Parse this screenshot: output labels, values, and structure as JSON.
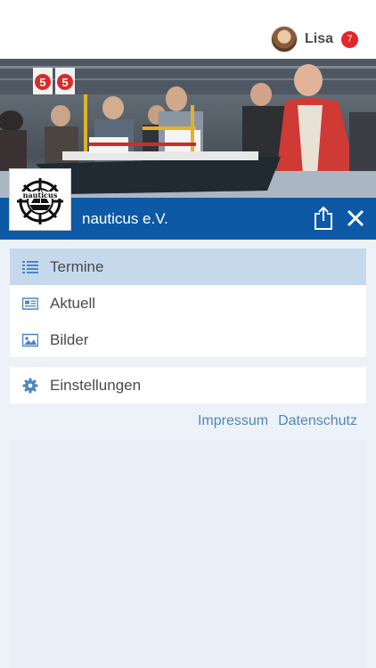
{
  "user": {
    "name": "Lisa",
    "notification_count": "7"
  },
  "organization": {
    "name": "nauticus e.V.",
    "logo_text": "nauticus"
  },
  "banner": {
    "sign_digits": [
      "5",
      "5"
    ]
  },
  "menu": {
    "items": [
      {
        "label": "Termine",
        "icon": "list-icon",
        "active": true
      },
      {
        "label": "Aktuell",
        "icon": "newspaper-icon",
        "active": false
      },
      {
        "label": "Bilder",
        "icon": "image-icon",
        "active": false
      }
    ],
    "settings": {
      "label": "Einstellungen",
      "icon": "gear-icon"
    }
  },
  "footer_links": {
    "impressum": "Impressum",
    "datenschutz": "Datenschutz"
  },
  "colors": {
    "brand_blue": "#0d59a6",
    "active_item": "#c6d8ec",
    "menu_background": "#edf2f9",
    "icon_blue": "#4b86c0",
    "link_color": "#4f86b8",
    "badge_red": "#e2262b"
  }
}
